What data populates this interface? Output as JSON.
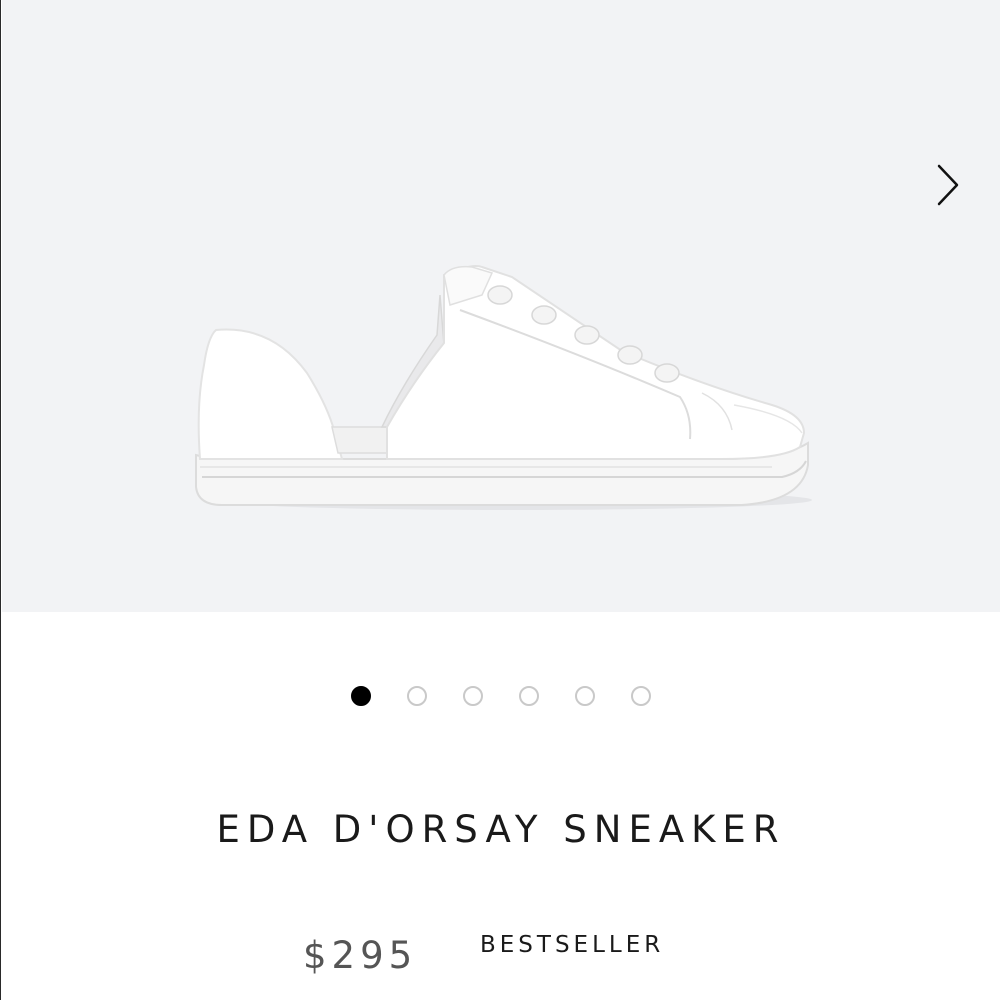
{
  "product": {
    "name": "EDA D'ORSAY SNEAKER",
    "price": "$295",
    "badge": "BESTSELLER",
    "image_alt": "White leather d'orsay sneaker"
  },
  "gallery": {
    "next_icon": "chevron-right-icon",
    "total_images": 6,
    "active_index": 0
  },
  "colors": {
    "gallery_bg": "#f2f3f5",
    "active_dot": "#000000",
    "inactive_dot_border": "#c9c9c9"
  }
}
